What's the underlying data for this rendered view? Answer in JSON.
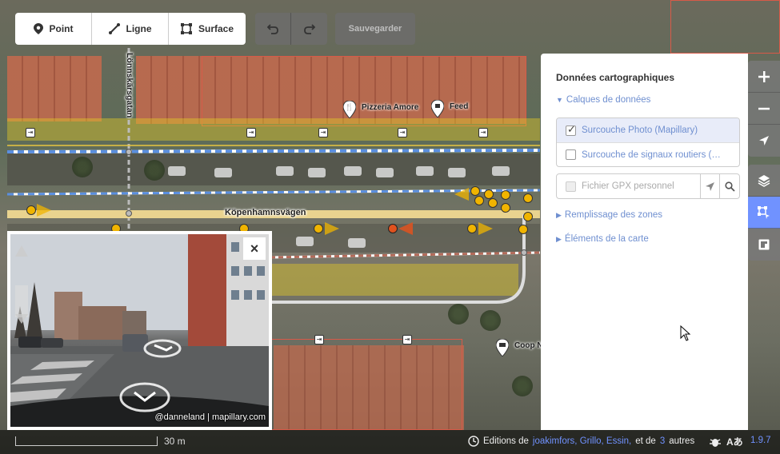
{
  "toolbar": {
    "modes": [
      {
        "label": "Point",
        "icon": "point-icon"
      },
      {
        "label": "Ligne",
        "icon": "line-icon"
      },
      {
        "label": "Surface",
        "icon": "area-icon"
      }
    ],
    "undo_icon": "undo-icon",
    "redo_icon": "redo-icon",
    "save_label": "Sauvegarder"
  },
  "map": {
    "road_name": "Köpenhamnsvägen",
    "side_street": "Lönnskärsgatan",
    "pois": [
      {
        "label": "Pizzeria Amore",
        "icon": "restaurant-icon"
      },
      {
        "label": "Feed",
        "icon": "fast-food-icon"
      },
      {
        "label": "Coop N",
        "icon": "shop-icon"
      }
    ]
  },
  "panel": {
    "title": "Données cartographiques",
    "layers_section": "Calques de données",
    "layers": [
      {
        "label": "Surcouche Photo (Mapillary)",
        "checked": true
      },
      {
        "label": "Surcouche de signaux routiers (…",
        "checked": false
      }
    ],
    "gpx_label": "Fichier GPX personnel",
    "fill_section": "Remplissage des zones",
    "features_section": "Éléments de la carte"
  },
  "controls": {
    "zoom_in": "+",
    "zoom_out": "−"
  },
  "viewer": {
    "close": "×",
    "credit": "@danneland | mapillary.com"
  },
  "footer": {
    "scale": "30 m",
    "editions_prefix": "Editions de",
    "editors": "joakimfors, Grillo, Essin,",
    "et_de": "et de",
    "others_count": "3",
    "autres": "autres",
    "translate_label": "Aあ",
    "version": "1.9.7"
  },
  "colors": {
    "accent": "#7092ff",
    "link": "#6f8fd0"
  }
}
